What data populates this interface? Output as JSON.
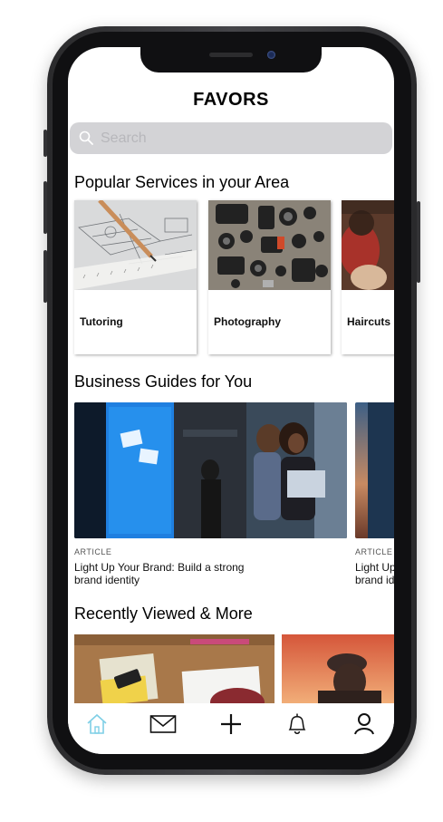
{
  "app": {
    "title": "FAVORS"
  },
  "search": {
    "placeholder": "Search",
    "value": ""
  },
  "sections": {
    "popular": {
      "heading": "Popular Services in your Area",
      "items": [
        {
          "label": "Tutoring",
          "image": "blueprint-pencil-photo"
        },
        {
          "label": "Photography",
          "image": "camera-gear-flatlay-photo"
        },
        {
          "label": "Haircuts",
          "image": "barber-photo"
        }
      ]
    },
    "guides": {
      "heading": "Business Guides for You",
      "items": [
        {
          "kicker": "ARTICLE",
          "title": "Light Up Your Brand: Build a strong brand identity",
          "image": "office-screen-people-photo"
        },
        {
          "kicker": "ARTICLE",
          "title": "Light Up Your Brand: Build a strong brand identity",
          "image": "sunset-photo"
        }
      ]
    },
    "recent": {
      "heading": "Recently Viewed & More",
      "items": [
        {
          "image": "desk-notebook-phone-photo"
        },
        {
          "image": "sunset-person-cap-photo"
        }
      ]
    }
  },
  "tabbar": {
    "items": [
      {
        "name": "home",
        "icon": "home-icon",
        "active": true
      },
      {
        "name": "messages",
        "icon": "mail-icon",
        "active": false
      },
      {
        "name": "create",
        "icon": "plus-icon",
        "active": false
      },
      {
        "name": "notifications",
        "icon": "bell-icon",
        "active": false
      },
      {
        "name": "profile",
        "icon": "user-icon",
        "active": false
      }
    ]
  },
  "colors": {
    "active_tab": "#7fcfe6",
    "search_bg": "#d3d3d6",
    "text": "#000000"
  }
}
